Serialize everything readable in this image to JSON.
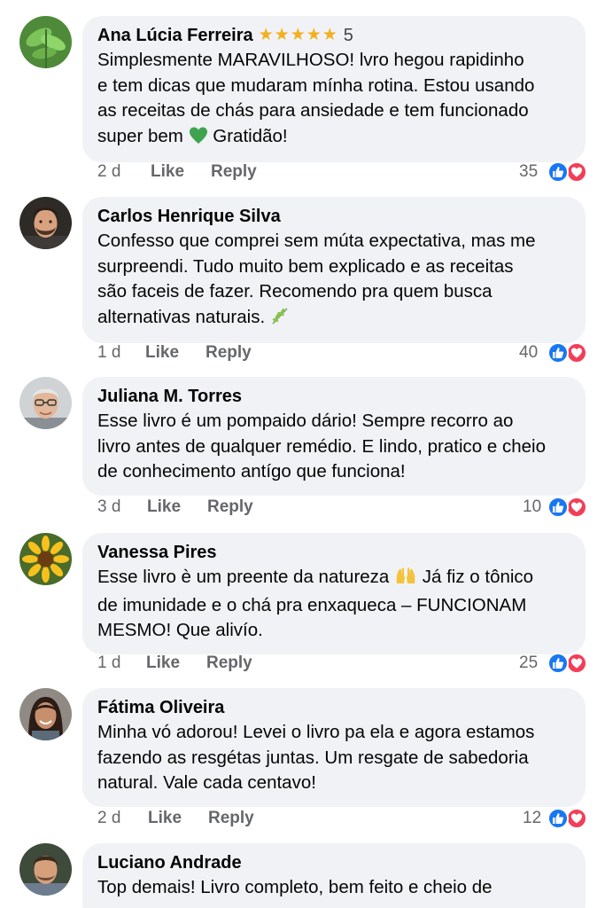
{
  "comments": [
    {
      "name": "Ana Lúcia Ferreira",
      "stars": "★★★★★",
      "rating": "5",
      "lines": [
        "Simplesmente MARAVILHOSO! lvro  hegou rapidinho",
        "e tem dicas que mudaram mínha rotina. Estou usando",
        "as receitas de chás para ansiedade e tem funcionado",
        "super bem",
        "Gratidão!"
      ],
      "time": "2 d",
      "like": "Like",
      "reply": "Reply",
      "reactions": "35",
      "avatar": "plant-leaf"
    },
    {
      "name": "Carlos Henrique Silva",
      "lines": [
        "Confesso que comprei sem múta expectativa, mas me",
        "surpreendi. Tudo muito bem explicado e as receitas",
        "são faceis de fazer. Recomendo pra quem busca",
        "alternativas naturais."
      ],
      "time": "1 d",
      "like": "Like",
      "reply": "Reply",
      "reactions": "40",
      "avatar": "man-beard"
    },
    {
      "name": "Juliana M. Torres",
      "lines": [
        "Esse livro é um pompaido dário! Sempre recorro ao",
        "livro antes de qualquer remédio. E lindo, pratico e cheio",
        "de conhecimento antígo que funciona!"
      ],
      "time": "3 d",
      "like": "Like",
      "reply": "Reply",
      "reactions": "10",
      "avatar": "older-man-glasses"
    },
    {
      "name": "Vanessa Pires",
      "lines": [
        "Esse livro è um preente da natureza",
        "Já fiz o tônico",
        "de imunidade e o chá pra enxaqueca – FUNCIONAM",
        "MESMO! Que alivío."
      ],
      "time": "1 d",
      "like": "Like",
      "reply": "Reply",
      "reactions": "25",
      "avatar": "sunflower"
    },
    {
      "name": "Fátima Oliveira",
      "lines": [
        "Minha vó adorou! Levei o livro pa ela e agora estamos",
        "fazendo as resgétas juntas. Um resgate de sabedoria",
        "natural. Vale cada centavo!"
      ],
      "time": "2 d",
      "like": "Like",
      "reply": "Reply",
      "reactions": "12",
      "avatar": "woman-smiling"
    },
    {
      "name": "Luciano Andrade",
      "lines": [
        "Top demais! Livro completo, bem feito e cheio de"
      ],
      "avatar": "man-young"
    }
  ],
  "colors": {
    "bubble": "#f0f2f5",
    "like_blue": "#1877f2",
    "love_red": "#f33e58",
    "star": "#f2b01e",
    "meta_gray": "#65676b"
  }
}
